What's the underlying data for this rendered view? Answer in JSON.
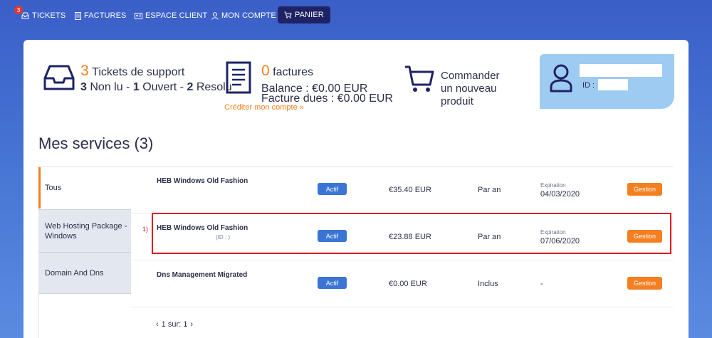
{
  "nav": {
    "badge_count": "3",
    "items": [
      {
        "label": "TICKETS",
        "icon": "inbox-icon"
      },
      {
        "label": "FACTURES",
        "icon": "document-icon"
      },
      {
        "label": "ESPACE CLIENT",
        "icon": "id-card-icon"
      },
      {
        "label": "MON COMPTE",
        "icon": "user-icon"
      },
      {
        "label": "PANIER",
        "icon": "cart-icon"
      }
    ]
  },
  "summary": {
    "tickets": {
      "count": "3",
      "title": "Tickets de support",
      "unread": "3",
      "unread_label": "Non lu -",
      "open": "1",
      "open_label": "Ouvert -",
      "resolved": "2",
      "resolved_label": "Resolu"
    },
    "invoices": {
      "count": "0",
      "title": "factures",
      "balance": "Balance : €0.00 EUR",
      "due": "Facture dues : €0.00 EUR",
      "credit_link": "Créditer mon compte »"
    },
    "order": {
      "line1": "Commander",
      "line2": "un nouveau",
      "line3": "produit"
    },
    "profile": {
      "id_label": "ID :"
    }
  },
  "services": {
    "title": "Mes services (3)",
    "tabs": [
      "Tous",
      "Web Hosting Package - Windows",
      "Domain And Dns"
    ],
    "rows": [
      {
        "name": "HEB Windows Old Fashion",
        "id_label": "",
        "status": "Actif",
        "price": "€35.40 EUR",
        "period": "Par an",
        "exp_label": "Expiration",
        "exp_date": "04/03/2020",
        "action": "Gestion"
      },
      {
        "name": "HEB Windows Old Fashion",
        "id_label": "(ID :          )",
        "status": "Actif",
        "price": "€23.88 EUR",
        "period": "Par an",
        "exp_label": "Expiration",
        "exp_date": "07/06/2020",
        "action": "Gestion"
      },
      {
        "name": "Dns Management Migrated",
        "id_label": "",
        "status": "Actif",
        "price": "€0.00 EUR",
        "period": "Inclus",
        "exp_label": "",
        "exp_date": "-",
        "action": "Gestion"
      }
    ],
    "marker": "1)",
    "pager": "1 sur: 1"
  },
  "colors": {
    "accent": "#f47f20",
    "primary": "#3a74d4",
    "navy": "#1f2366",
    "highlight": "#e0171c"
  }
}
